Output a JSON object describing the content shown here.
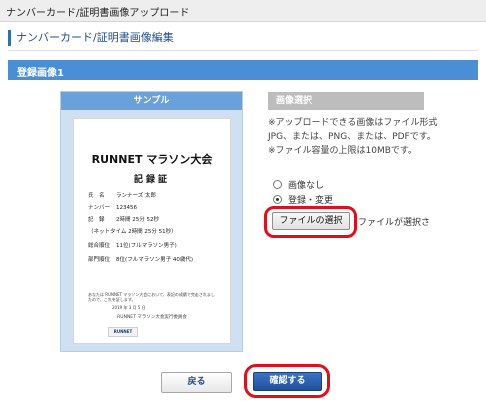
{
  "top_bar": {
    "title": "ナンバーカード/証明書画像アップロード"
  },
  "section": {
    "title": "ナンバーカード/証明書画像編集"
  },
  "panel": {
    "title": "登録画像1"
  },
  "sample": {
    "header": "サンプル",
    "certificate": {
      "event": "RUNNET マラソン大会",
      "heading": "記録証",
      "rows": [
        {
          "key": "氏　名",
          "value": "ランナーズ 太郎"
        },
        {
          "key": "ナンバー",
          "value": "123456"
        },
        {
          "key": "記　録",
          "value": "2時間 25分 52秒"
        },
        {
          "key": "",
          "value": "（ネットタイム 2時間 25分 51秒）"
        },
        {
          "key": "総合順位",
          "value": "11位(フルマラソン男子)"
        },
        {
          "key": "部門順位",
          "value": "8位(フルマラソン男子 40歳代)"
        }
      ],
      "note": "あなたは RUNNET マラソン大会において、表記の成績で完走されましたので、これを証します。",
      "date": "2019 年 3 月 5 日",
      "organizer": "RUNNET マラソン大会実行委員会",
      "logo": "RUNNET"
    }
  },
  "image_select": {
    "header": "画像選択",
    "info": [
      "※アップロードできる画像はファイル形式JPG、または、PNG、または、PDFです。",
      "※ファイル容量の上限は10MBです。"
    ],
    "options": [
      {
        "label": "画像なし",
        "selected": false
      },
      {
        "label": "登録・変更",
        "selected": true
      }
    ],
    "file_button": "ファイルの選択",
    "file_status": "ファイルが選択さ"
  },
  "buttons": {
    "back": "戻る",
    "confirm": "確認する"
  },
  "colors": {
    "accent": "#4a8fd6",
    "confirm": "#2a5eae",
    "highlight": "#e0101a"
  }
}
